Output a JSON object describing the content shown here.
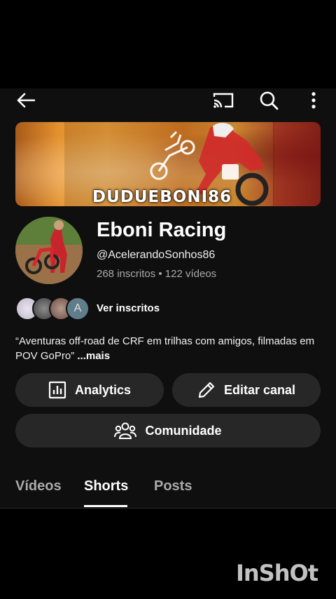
{
  "header": {
    "icons": [
      "back-arrow-icon",
      "cast-icon",
      "search-icon",
      "more-vert-icon"
    ]
  },
  "banner": {
    "text": "DUDUEBONI86"
  },
  "channel": {
    "title": "Eboni Racing",
    "handle": "@AcelerandoSonhos86",
    "stats": "268 inscritos • 122 vídeos"
  },
  "subscribers": {
    "initial": "A",
    "label": "Ver inscritos"
  },
  "description": {
    "text": "“Aventuras off-road de CRF em trilhas com amigos, filmadas em POV GoPro”",
    "more": "...mais"
  },
  "actions": {
    "analytics": "Analytics",
    "edit_channel": "Editar canal",
    "community": "Comunidade"
  },
  "tabs": [
    {
      "label": "Vídeos",
      "active": false
    },
    {
      "label": "Shorts",
      "active": true
    },
    {
      "label": "Posts",
      "active": false
    }
  ],
  "watermark": "InShOt",
  "colors": {
    "background": "#0f0f0f",
    "pill": "#272727",
    "muted_text": "#aaaaaa"
  }
}
